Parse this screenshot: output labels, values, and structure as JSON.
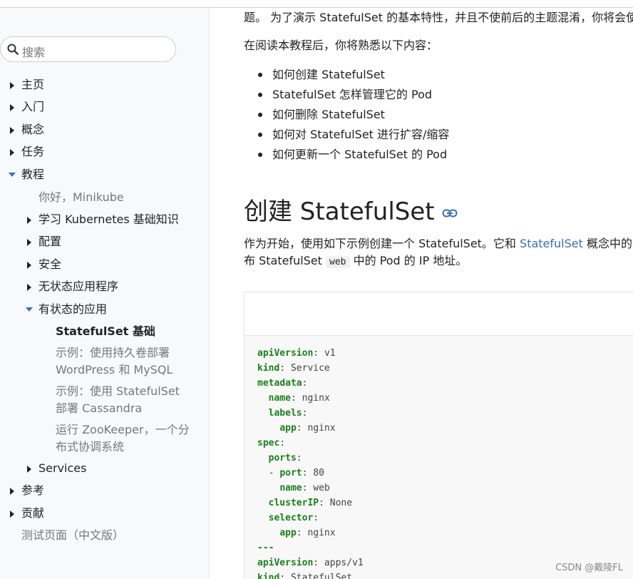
{
  "sidebar": {
    "search_placeholder": "搜索",
    "items": [
      {
        "label": "主页"
      },
      {
        "label": "入门"
      },
      {
        "label": "概念"
      },
      {
        "label": "任务"
      },
      {
        "label": "教程"
      },
      {
        "label": "你好，Minikube"
      },
      {
        "label": "学习 Kubernetes 基础知识"
      },
      {
        "label": "配置"
      },
      {
        "label": "安全"
      },
      {
        "label": "无状态应用程序"
      },
      {
        "label": "有状态的应用"
      },
      {
        "label": "StatefulSet 基础"
      },
      {
        "label": "示例：使用持久卷部署 WordPress 和 MySQL"
      },
      {
        "label": "示例：使用 StatefulSet 部署 Cassandra"
      },
      {
        "label": "运行 ZooKeeper，一个分布式协调系统"
      },
      {
        "label": "Services"
      },
      {
        "label": "参考"
      },
      {
        "label": "贡献"
      },
      {
        "label": "测试页面（中文版）"
      }
    ]
  },
  "main": {
    "intro_line": "题。 为了演示 StatefulSet 的基本特性，并且不使前后的主题混淆，你将会使用",
    "after_reading": "在阅读本教程后，你将熟悉以下内容：",
    "bullets": [
      "如何创建 StatefulSet",
      "StatefulSet 怎样管理它的 Pod",
      "如何删除 StatefulSet",
      "如何对 StatefulSet 进行扩容/缩容",
      "如何更新一个 StatefulSet 的 Pod"
    ],
    "heading": "创建 StatefulSet",
    "para1_a": "作为开始，使用如下示例创建一个 StatefulSet。它和 ",
    "para1_link": "StatefulSet",
    "para1_b": " 概念中的示例",
    "para2_a": "布 StatefulSet ",
    "para2_code": "web",
    "para2_b": " 中的 Pod 的 IP 地址。"
  },
  "code": {
    "lines": [
      {
        "key": "apiVersion",
        "sep": ": ",
        "val": "v1",
        "indent": ""
      },
      {
        "key": "kind",
        "sep": ": ",
        "val": "Service",
        "indent": ""
      },
      {
        "key": "metadata",
        "sep": ":",
        "val": "",
        "indent": ""
      },
      {
        "key": "name",
        "sep": ": ",
        "val": "nginx",
        "indent": "  "
      },
      {
        "key": "labels",
        "sep": ":",
        "val": "",
        "indent": "  "
      },
      {
        "key": "app",
        "sep": ": ",
        "val": "nginx",
        "indent": "    "
      },
      {
        "key": "spec",
        "sep": ":",
        "val": "",
        "indent": ""
      },
      {
        "key": "ports",
        "sep": ":",
        "val": "",
        "indent": "  "
      },
      {
        "key": "port",
        "sep": ": ",
        "val": "80",
        "indent": "  - "
      },
      {
        "key": "name",
        "sep": ": ",
        "val": "web",
        "indent": "    "
      },
      {
        "key": "clusterIP",
        "sep": ": ",
        "val": "None",
        "indent": "  "
      },
      {
        "key": "selector",
        "sep": ":",
        "val": "",
        "indent": "  "
      },
      {
        "key": "app",
        "sep": ": ",
        "val": "nginx",
        "indent": "    "
      },
      {
        "key": "---",
        "sep": "",
        "val": "",
        "indent": ""
      },
      {
        "key": "apiVersion",
        "sep": ": ",
        "val": "apps/v1",
        "indent": ""
      },
      {
        "key": "kind",
        "sep": ": ",
        "val": "StatefulSet",
        "indent": ""
      }
    ]
  },
  "watermark": "CSDN @戴陵FL"
}
